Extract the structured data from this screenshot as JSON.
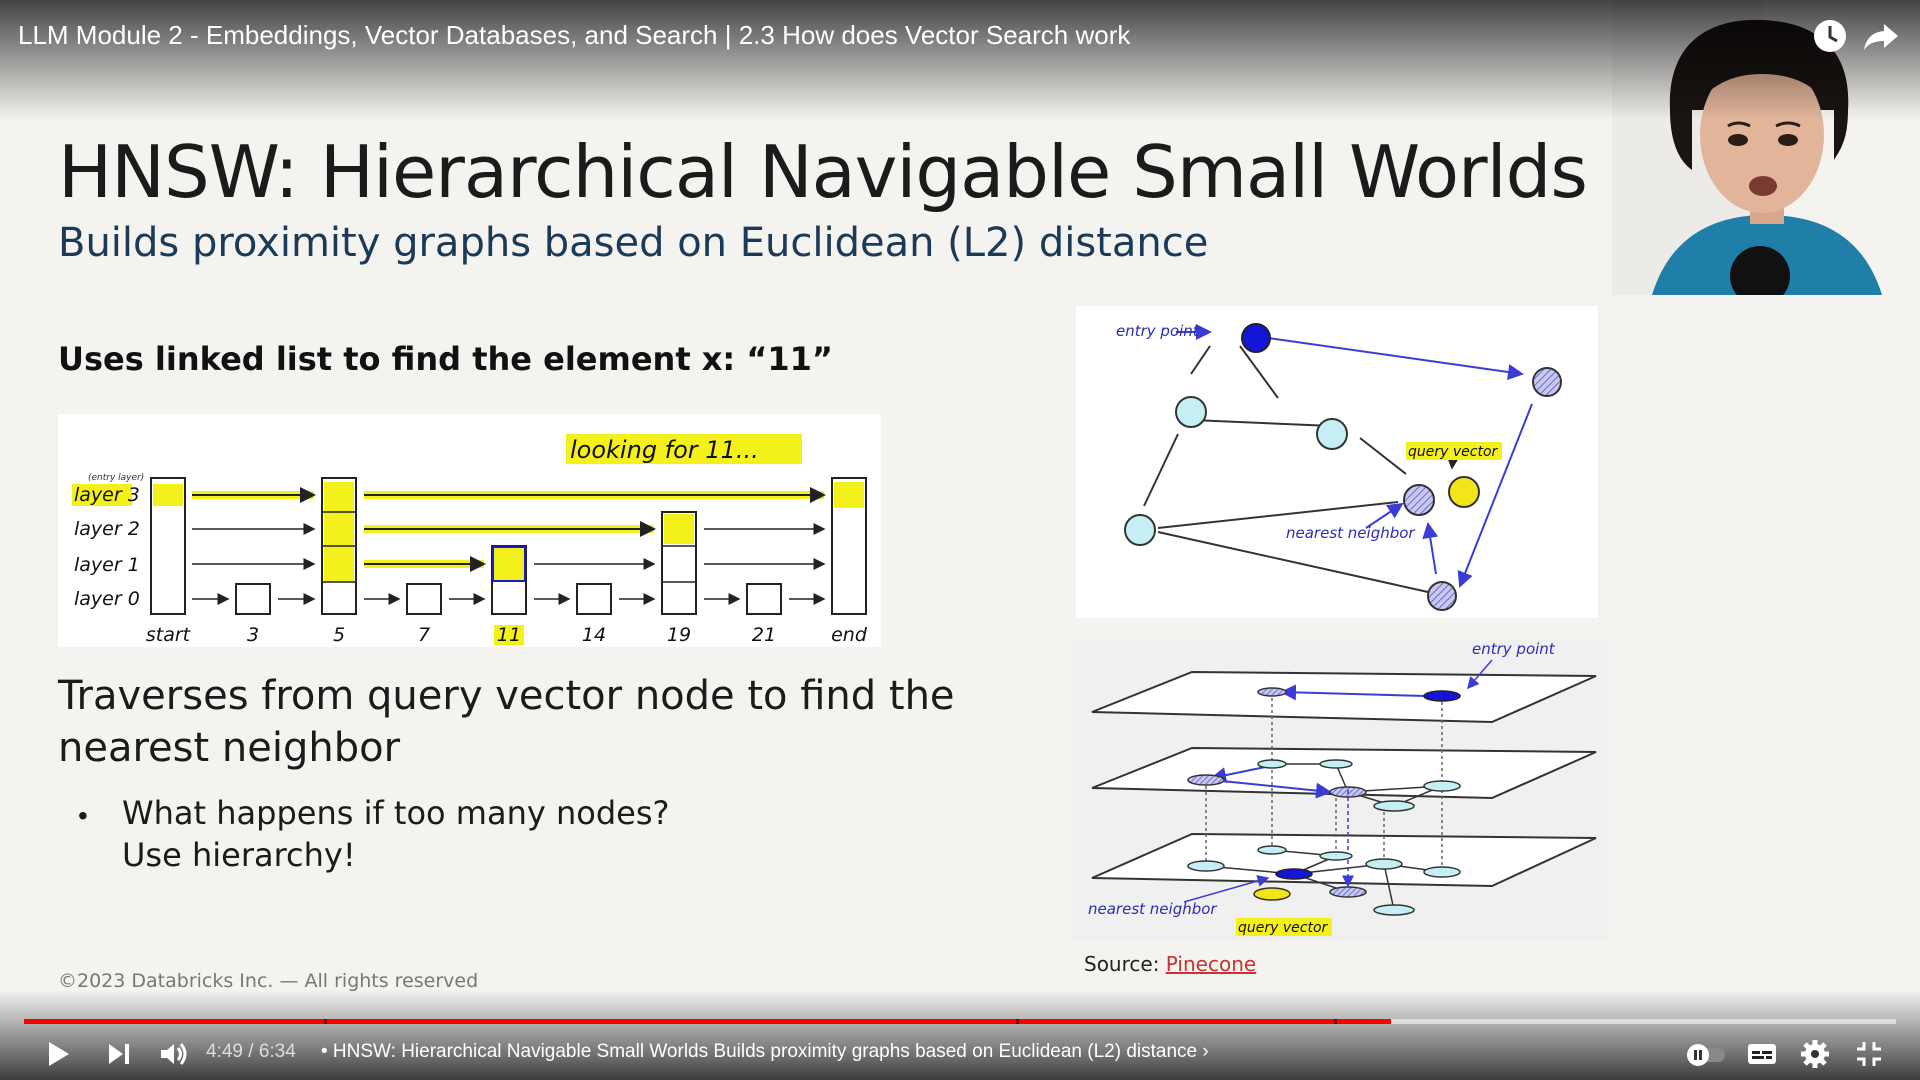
{
  "player": {
    "video_title": "LLM Module 2 - Embeddings, Vector Databases, and Search | 2.3 How does Vector Search work",
    "time_current": "4:49",
    "time_total": "6:34",
    "chapter_title": "• HNSW: Hierarchical Navigable Small Worlds Builds proximity graphs based on Euclidean (L2) distance ›",
    "progress_fraction": 0.73,
    "chapter_markers": [
      0.16,
      0.53,
      0.7
    ],
    "accent_color": "#ff0000"
  },
  "slide": {
    "title": "HNSW: Hierarchical Navigable Small Worlds",
    "subtitle": "Builds proximity graphs based on Euclidean (L2) distance",
    "heading": "Uses linked list to find the element x: “11”",
    "body": "Traverses from query vector node to find the nearest neighbor",
    "bullet_line1": "What happens if too many nodes?",
    "bullet_line2": "Use hierarchy!",
    "source_label": "Source:",
    "source_link": "Pinecone",
    "copyright": "©2023 Databricks Inc. — All rights reserved"
  },
  "linked_list": {
    "banner": "looking for 11...",
    "entry_note": "(entry layer)",
    "layers": [
      "layer 3",
      "layer 2",
      "layer 1",
      "layer 0"
    ],
    "labels": [
      "start",
      "3",
      "5",
      "7",
      "11",
      "14",
      "19",
      "21",
      "end"
    ]
  },
  "graph": {
    "entry_point": "entry point",
    "query_vector": "query vector",
    "nearest_neighbor": "nearest neighbor"
  },
  "layers_fig": {
    "entry_point": "entry point",
    "nearest_neighbor": "nearest neighbor",
    "query_vector": "query vector"
  },
  "icons": {
    "watch_later": "clock-icon",
    "share": "share-icon",
    "play": "play-icon",
    "next": "next-icon",
    "volume": "volume-icon",
    "autoplay": "autoplay-toggle-icon",
    "captions": "captions-icon",
    "settings": "gear-icon",
    "exit_fullscreen": "exit-fullscreen-icon"
  }
}
